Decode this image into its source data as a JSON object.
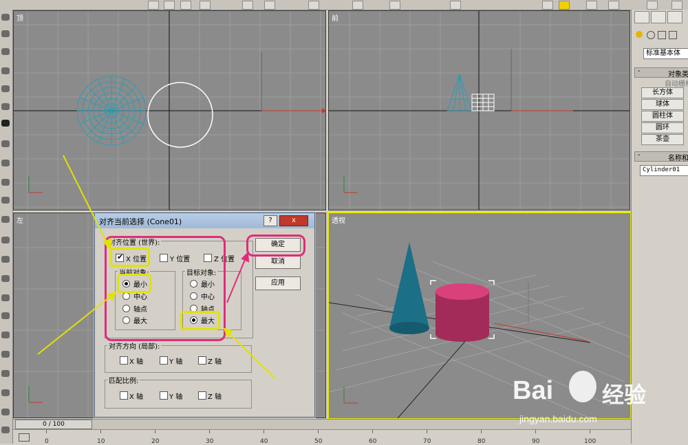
{
  "viewports": {
    "top": {
      "label": "顶"
    },
    "front": {
      "label": "前"
    },
    "left": {
      "label": "左"
    },
    "perspective": {
      "label": "透视"
    }
  },
  "command_panel": {
    "dropdown_value": "标准基本体",
    "object_type_rollout": "对象类",
    "autogrid_label": "自动栅格",
    "object_buttons": [
      "长方体",
      "球体",
      "圆柱体",
      "圆环",
      "茶壶"
    ],
    "name_color_rollout": "名称和",
    "object_name": "Cylinder01"
  },
  "dialog": {
    "title": "对齐当前选择 (Cone01)",
    "help_label": "?",
    "close_label": "x",
    "align_position_group": "对齐位置 (世界):",
    "x_position": {
      "label": "X 位置",
      "checked": true
    },
    "y_position": {
      "label": "Y 位置",
      "checked": false
    },
    "z_position": {
      "label": "Z 位置",
      "checked": false
    },
    "current_object_group": "当前对象:",
    "target_object_group": "目标对象:",
    "current_options": [
      "最小",
      "中心",
      "轴点",
      "最大"
    ],
    "current_selected": "最小",
    "target_options": [
      "最小",
      "中心",
      "轴点",
      "最大"
    ],
    "target_selected": "最大",
    "ok_label": "确定",
    "cancel_label": "取消",
    "apply_label": "应用",
    "align_orientation_group": "对齐方向 (局部):",
    "orientation_axes": [
      "X 轴",
      "Y 轴",
      "Z 轴"
    ],
    "match_scale_group": "匹配比例:",
    "scale_axes": [
      "X 轴",
      "Y 轴",
      "Z 轴"
    ]
  },
  "timeline": {
    "slider_text": "0 / 100",
    "ruler_labels": [
      "0",
      "10",
      "20",
      "30",
      "40",
      "50",
      "60",
      "70",
      "80",
      "90",
      "100"
    ]
  },
  "watermark": {
    "brand_latin": "Bai",
    "brand_chinese": "经验",
    "url": "jingyan.baidu.com"
  },
  "colors": {
    "viewport_bg": "#8b8b8b",
    "active_viewport_border": "#e8e800",
    "cone_mesh": "#1a7a9a",
    "cylinder": "#c8386e",
    "highlight_yellow": "#e2e200",
    "highlight_magenta": "#e02c78"
  }
}
